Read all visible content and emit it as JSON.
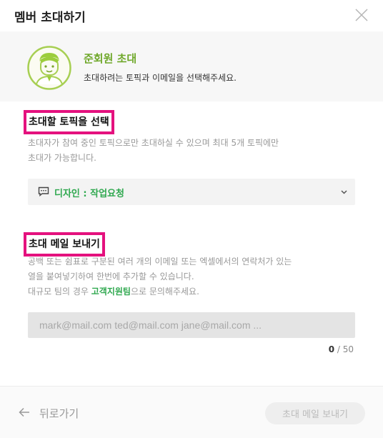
{
  "modal": {
    "title": "멤버 초대하기",
    "close_icon": "close-icon"
  },
  "banner": {
    "avatar_icon": "user-avatar-icon",
    "title": "준회원 초대",
    "description": "초대하려는 토픽과 이메일을 선택해주세요."
  },
  "topic_section": {
    "title": "초대할 토픽을 선택",
    "help_line1": "초대자가 참여 중인 토픽으로만 초대하실 수 있으며 최대 5개 토픽에만",
    "help_line2": "초대가 가능합니다.",
    "select_icon": "chat-bubble-icon",
    "selected_value": "디자인 : 작업요청",
    "chevron_icon": "chevron-down-icon"
  },
  "email_section": {
    "title": "초대 메일 보내기",
    "help_line1": "공백 또는 쉼표로 구분된 여러 개의 이메일 또는 엑셀에서의 연락처가 있는",
    "help_line2": "열을 붙여넣기하여 한번에 추가할 수 있습니다.",
    "help_line3_prefix": "대규모 팀의 경우 ",
    "help_line3_link": "고객지원팀",
    "help_line3_suffix": "으로 문의해주세요.",
    "input_value": "",
    "input_placeholder": "mark@mail.com ted@mail.com jane@mail.com ...",
    "count_current": "0",
    "count_separator": " / ",
    "count_max": "50"
  },
  "footer": {
    "back_icon": "arrow-left-icon",
    "back_label": "뒤로가기",
    "send_label": "초대 메일 보내기"
  },
  "colors": {
    "accent_green": "#2fa84f",
    "banner_green": "#6fa82a",
    "highlight_magenta": "#e4117e"
  }
}
